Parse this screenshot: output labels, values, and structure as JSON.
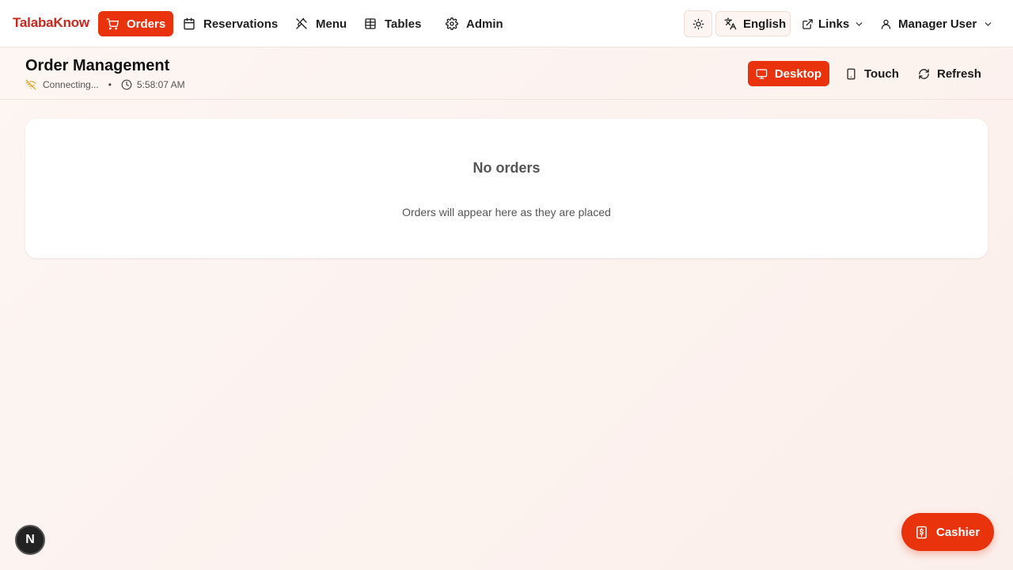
{
  "brand": {
    "name": "TalabaKnow",
    "color": "#c8281e"
  },
  "nav": {
    "orders": {
      "label": "Orders",
      "icon": "cart-icon"
    },
    "reservations": {
      "label": "Reservations",
      "icon": "calendar-icon"
    },
    "menu": {
      "label": "Menu",
      "icon": "utensils-icon"
    },
    "tables": {
      "label": "Tables",
      "icon": "table-icon"
    },
    "admin": {
      "label": "Admin",
      "icon": "gear-icon"
    }
  },
  "header_actions": {
    "theme_icon": "sun-icon",
    "language_label": "English",
    "links_label": "Links",
    "user_label": "Manager User"
  },
  "page": {
    "title": "Order Management",
    "connection_status": "Connecting...",
    "separator": "•",
    "time": "5:58:07 AM"
  },
  "view_toggle": {
    "desktop_label": "Desktop",
    "touch_label": "Touch",
    "refresh_label": "Refresh"
  },
  "empty_state": {
    "title": "No orders",
    "message": "Orders will appear here as they are placed"
  },
  "floating": {
    "badge_letter": "N",
    "cashier_label": "Cashier"
  },
  "colors": {
    "accent": "#e8330d",
    "warning_icon": "#e0a020"
  }
}
